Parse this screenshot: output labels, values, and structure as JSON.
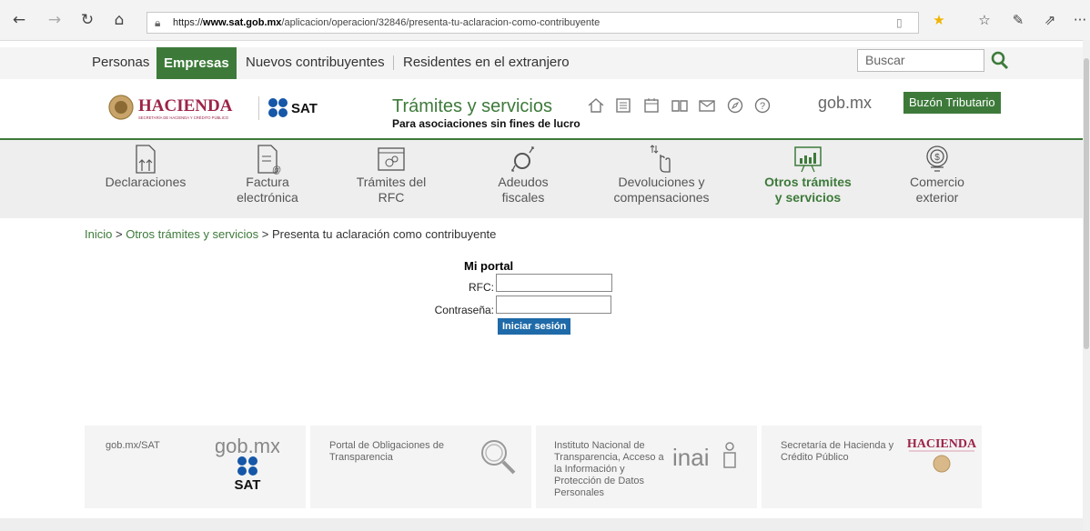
{
  "browser": {
    "url_prefix": "https://",
    "url_domain": "www.sat.gob.mx",
    "url_path": "/aplicacion/operacion/32846/presenta-tu-aclaracion-como-contribuyente",
    "more": "···"
  },
  "topnav": {
    "items": [
      "Personas",
      "Empresas",
      "Nuevos contribuyentes",
      "Residentes en el extranjero"
    ],
    "active": "Empresas",
    "search_placeholder": "Buscar"
  },
  "header": {
    "hacienda_logo_text": "HACIENDA",
    "hacienda_logo_subtext": "SECRETARÍA DE HACIENDA Y CRÉDITO PÚBLICO",
    "sat_logo_text": "SAT",
    "title": "Trámites y servicios",
    "subtitle": "Para asociaciones sin fines de lucro",
    "gobmx": "gob.mx",
    "buzon": "Buzón Tributario"
  },
  "services": [
    {
      "label": "Declaraciones",
      "icon": "declaraciones-icon"
    },
    {
      "label": "Factura electrónica",
      "icon": "factura-icon"
    },
    {
      "label": "Trámites del RFC",
      "icon": "rfc-icon"
    },
    {
      "label": "Adeudos fiscales",
      "icon": "adeudos-icon"
    },
    {
      "label": "Devoluciones y compensaciones",
      "icon": "devoluciones-icon"
    },
    {
      "label": "Otros trámites y servicios",
      "icon": "otros-tramites-icon",
      "active": true
    },
    {
      "label": "Comercio exterior",
      "icon": "comercio-exterior-icon"
    }
  ],
  "breadcrumb": {
    "home": "Inicio",
    "section": "Otros trámites y servicios",
    "current": "Presenta tu aclaración como contribuyente",
    "sep": ">"
  },
  "login": {
    "title": "Mi portal",
    "rfc_label": "RFC:",
    "password_label": "Contraseña:",
    "button": "Iniciar sesión"
  },
  "footer": {
    "cards": [
      {
        "text": "gob.mx/SAT",
        "logo_text": "gob.mx",
        "logo_sub": "SAT"
      },
      {
        "text": "Portal de Obligaciones de Transparencia"
      },
      {
        "text": "Instituto Nacional de Transparencia, Acceso a la Información y Protección de Datos Personales",
        "logo_text": "inai"
      },
      {
        "text": "Secretaría de Hacienda y Crédito Público",
        "logo_text": "HACIENDA"
      }
    ]
  },
  "colors": {
    "brand_green": "#3d7a3a",
    "button_blue": "#1f6aa8",
    "hacienda_red": "#9d2449"
  }
}
